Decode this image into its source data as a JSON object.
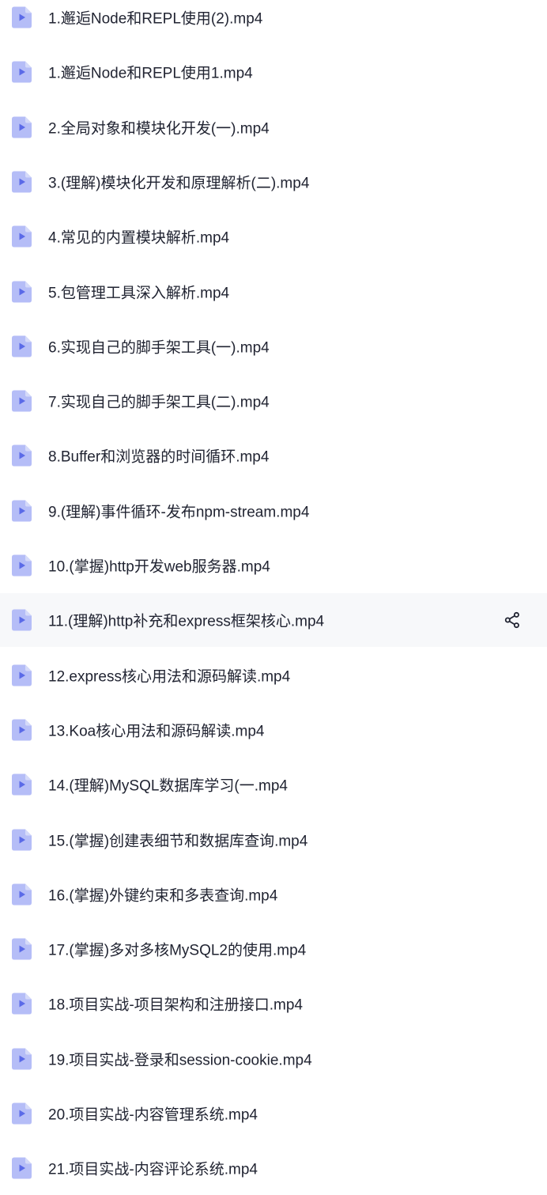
{
  "colors": {
    "icon_fill": "#b5bdf7",
    "icon_play": "#5a6ae8",
    "hover_background": "#f7f8fa",
    "text": "#212432"
  },
  "hovered_index": 11,
  "row_actions": {
    "share_icon": "share-icon"
  },
  "files": [
    {
      "name": "1.邂逅Node和REPL使用(2).mp4",
      "icon": "video-file-icon"
    },
    {
      "name": "1.邂逅Node和REPL使用1.mp4",
      "icon": "video-file-icon"
    },
    {
      "name": "2.全局对象和模块化开发(一).mp4",
      "icon": "video-file-icon"
    },
    {
      "name": "3.(理解)模块化开发和原理解析(二).mp4",
      "icon": "video-file-icon"
    },
    {
      "name": "4.常见的内置模块解析.mp4",
      "icon": "video-file-icon"
    },
    {
      "name": "5.包管理工具深入解析.mp4",
      "icon": "video-file-icon"
    },
    {
      "name": "6.实现自己的脚手架工具(一).mp4",
      "icon": "video-file-icon"
    },
    {
      "name": "7.实现自己的脚手架工具(二).mp4",
      "icon": "video-file-icon"
    },
    {
      "name": "8.Buffer和浏览器的时间循环.mp4",
      "icon": "video-file-icon"
    },
    {
      "name": "9.(理解)事件循环-发布npm-stream.mp4",
      "icon": "video-file-icon"
    },
    {
      "name": "10.(掌握)http开发web服务器.mp4",
      "icon": "video-file-icon"
    },
    {
      "name": "11.(理解)http补充和express框架核心.mp4",
      "icon": "video-file-icon"
    },
    {
      "name": "12.express核心用法和源码解读.mp4",
      "icon": "video-file-icon"
    },
    {
      "name": "13.Koa核心用法和源码解读.mp4",
      "icon": "video-file-icon"
    },
    {
      "name": "14.(理解)MySQL数据库学习(一.mp4",
      "icon": "video-file-icon"
    },
    {
      "name": "15.(掌握)创建表细节和数据库查询.mp4",
      "icon": "video-file-icon"
    },
    {
      "name": "16.(掌握)外键约束和多表查询.mp4",
      "icon": "video-file-icon"
    },
    {
      "name": "17.(掌握)多对多核MySQL2的使用.mp4",
      "icon": "video-file-icon"
    },
    {
      "name": "18.项目实战-项目架构和注册接口.mp4",
      "icon": "video-file-icon"
    },
    {
      "name": "19.项目实战-登录和session-cookie.mp4",
      "icon": "video-file-icon"
    },
    {
      "name": "20.项目实战-内容管理系统.mp4",
      "icon": "video-file-icon"
    },
    {
      "name": "21.项目实战-内容评论系统.mp4",
      "icon": "video-file-icon"
    }
  ]
}
